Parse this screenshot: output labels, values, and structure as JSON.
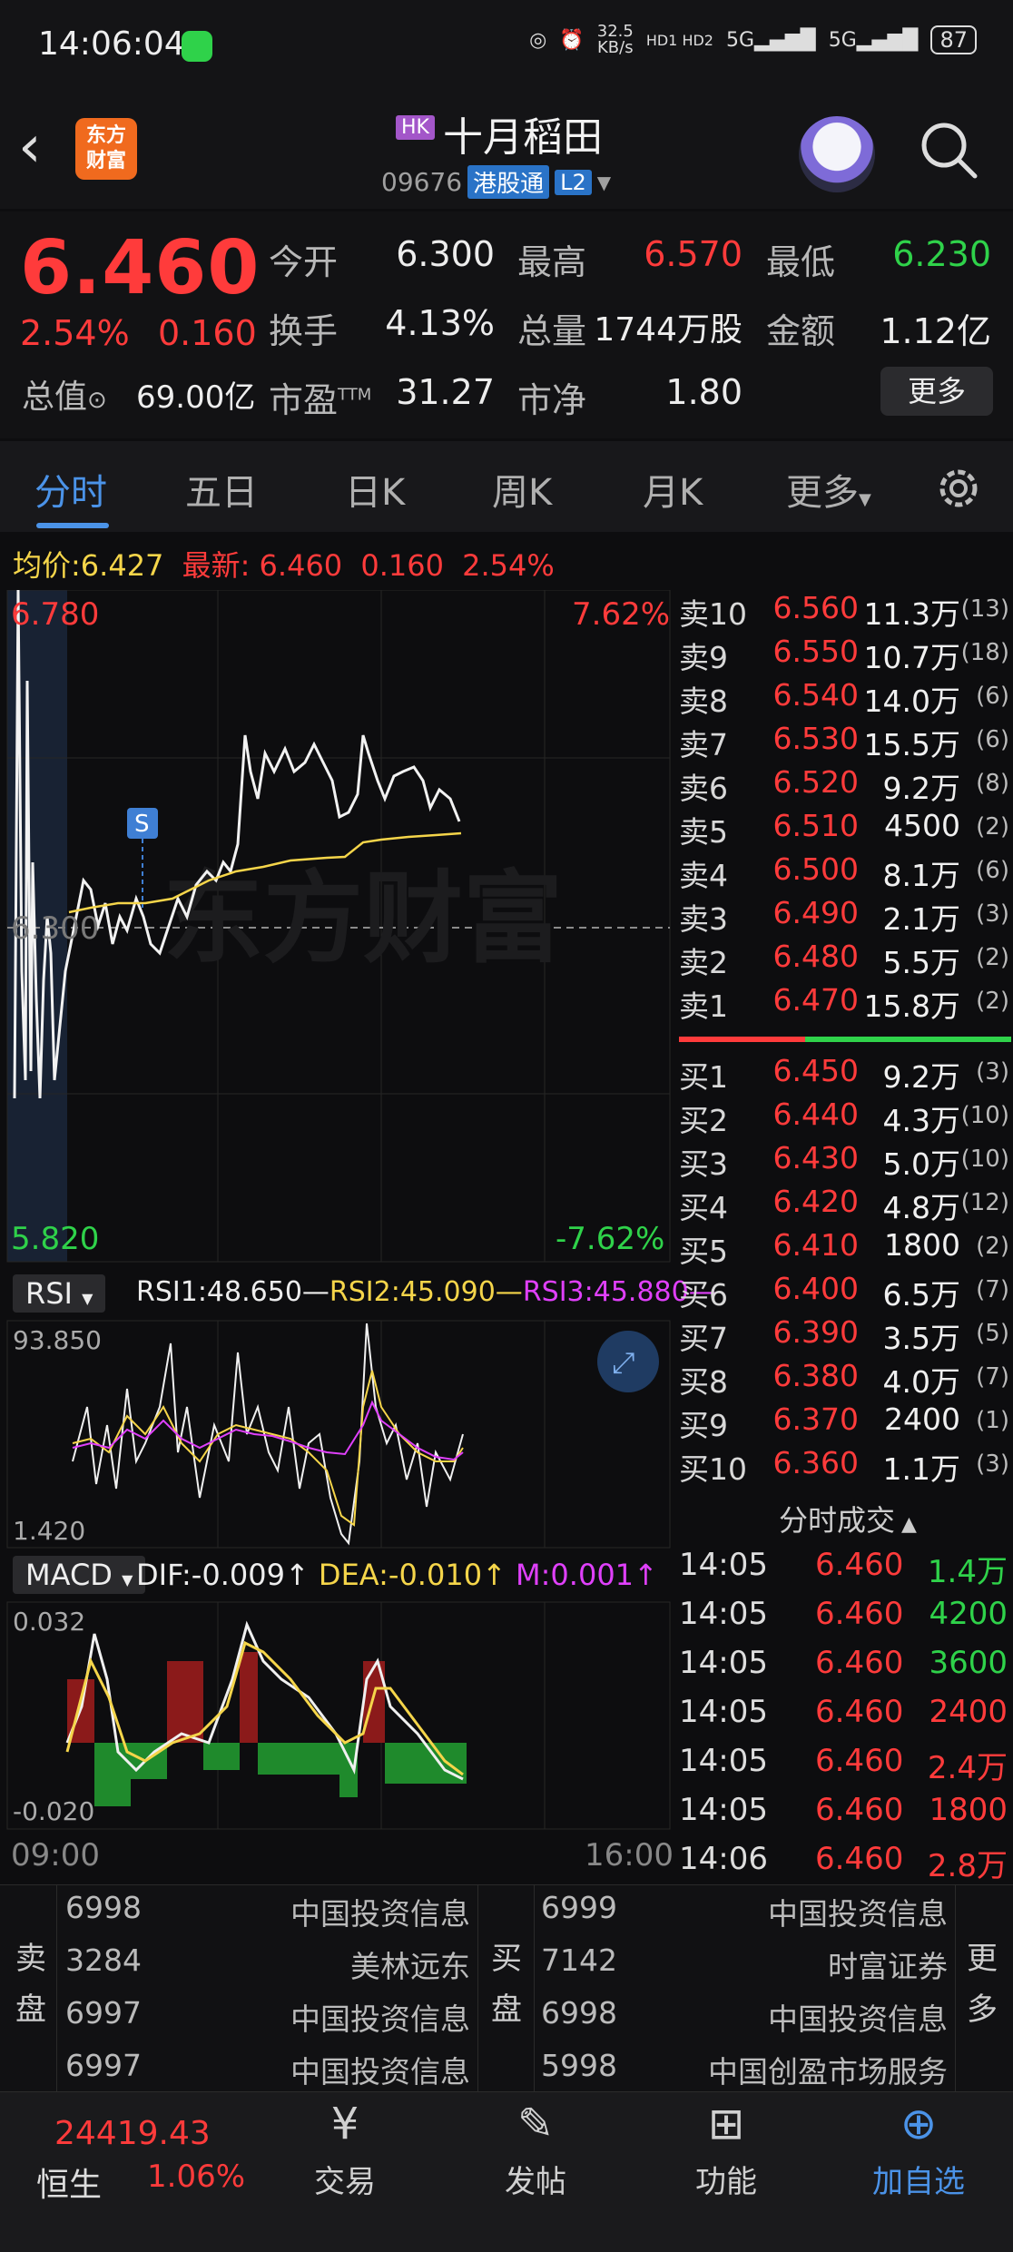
{
  "status_bar": {
    "time": "14:06:04",
    "net_speed_top": "32.5",
    "net_speed_bottom": "KB/s",
    "hd_badges": "HD1 HD2",
    "signal1": "5G",
    "signal2": "5G",
    "battery": "87"
  },
  "header": {
    "logo_line1": "东方",
    "logo_line2": "财富",
    "market_tag": "HK",
    "title": "十月稻田",
    "code": "09676",
    "connect_tag": "港股通",
    "level_tag": "L2"
  },
  "quote": {
    "price": "6.460",
    "pct": "2.54%",
    "change": "0.160",
    "mcap_label": "总值",
    "mcap_value": "69.00亿",
    "open_label": "今开",
    "open_value": "6.300",
    "high_label": "最高",
    "high_value": "6.570",
    "low_label": "最低",
    "low_value": "6.230",
    "turnover_label": "换手",
    "turnover_value": "4.13%",
    "volume_label": "总量",
    "volume_value": "1744万股",
    "amount_label": "金额",
    "amount_value": "1.12亿",
    "pe_label": "市盈",
    "pe_sup": "TTM",
    "pe_value": "31.27",
    "pb_label": "市净",
    "pb_value": "1.80",
    "more_button": "更多"
  },
  "tabs": [
    "分时",
    "五日",
    "日K",
    "周K",
    "月K",
    "更多"
  ],
  "info_line": {
    "avg_label": "均价:",
    "avg_value": "6.427",
    "latest_label": "最新:",
    "latest_value": "6.460",
    "latest_change": "0.160",
    "latest_pct": "2.54%"
  },
  "main_chart": {
    "y_top": "6.780",
    "y_bottom": "5.820",
    "pct_top": "7.62%",
    "pct_bottom": "-7.62%",
    "baseline": "6.300",
    "marker": "S",
    "watermark": "东方财富",
    "time_start": "09:00",
    "time_end": "16:00"
  },
  "rsi": {
    "button": "RSI",
    "rsi1": "RSI1:48.650—",
    "rsi2": "RSI2:45.090—",
    "rsi3": "RSI3:45.880—",
    "y_top": "93.850",
    "y_bottom": "1.420"
  },
  "macd": {
    "button": "MACD",
    "dif": "DIF:-0.009↑",
    "dea": "DEA:-0.010↑",
    "m": "M:0.001↑",
    "y_top": "0.032",
    "y_bottom": "-0.020"
  },
  "order_book": {
    "asks": [
      {
        "label": "卖10",
        "price": "6.560",
        "vol": "11.3万",
        "cnt": "(13)"
      },
      {
        "label": "卖9",
        "price": "6.550",
        "vol": "10.7万",
        "cnt": "(18)"
      },
      {
        "label": "卖8",
        "price": "6.540",
        "vol": "14.0万",
        "cnt": "(6)"
      },
      {
        "label": "卖7",
        "price": "6.530",
        "vol": "15.5万",
        "cnt": "(6)"
      },
      {
        "label": "卖6",
        "price": "6.520",
        "vol": "9.2万",
        "cnt": "(8)"
      },
      {
        "label": "卖5",
        "price": "6.510",
        "vol": "4500",
        "cnt": "(2)"
      },
      {
        "label": "卖4",
        "price": "6.500",
        "vol": "8.1万",
        "cnt": "(6)"
      },
      {
        "label": "卖3",
        "price": "6.490",
        "vol": "2.1万",
        "cnt": "(3)"
      },
      {
        "label": "卖2",
        "price": "6.480",
        "vol": "5.5万",
        "cnt": "(2)"
      },
      {
        "label": "卖1",
        "price": "6.470",
        "vol": "15.8万",
        "cnt": "(2)"
      }
    ],
    "bids": [
      {
        "label": "买1",
        "price": "6.450",
        "vol": "9.2万",
        "cnt": "(3)"
      },
      {
        "label": "买2",
        "price": "6.440",
        "vol": "4.3万",
        "cnt": "(10)"
      },
      {
        "label": "买3",
        "price": "6.430",
        "vol": "5.0万",
        "cnt": "(10)"
      },
      {
        "label": "买4",
        "price": "6.420",
        "vol": "4.8万",
        "cnt": "(12)"
      },
      {
        "label": "买5",
        "price": "6.410",
        "vol": "1800",
        "cnt": "(2)"
      },
      {
        "label": "买6",
        "price": "6.400",
        "vol": "6.5万",
        "cnt": "(7)"
      },
      {
        "label": "买7",
        "price": "6.390",
        "vol": "3.5万",
        "cnt": "(5)"
      },
      {
        "label": "买8",
        "price": "6.380",
        "vol": "4.0万",
        "cnt": "(7)"
      },
      {
        "label": "买9",
        "price": "6.370",
        "vol": "2400",
        "cnt": "(1)"
      },
      {
        "label": "买10",
        "price": "6.360",
        "vol": "1.1万",
        "cnt": "(3)"
      }
    ]
  },
  "trades": {
    "title": "分时成交",
    "rows": [
      {
        "time": "14:05",
        "price": "6.460",
        "vol": "1.4万",
        "color": "#2fd24a"
      },
      {
        "time": "14:05",
        "price": "6.460",
        "vol": "4200",
        "color": "#2fd24a"
      },
      {
        "time": "14:05",
        "price": "6.460",
        "vol": "3600",
        "color": "#2fd24a"
      },
      {
        "time": "14:05",
        "price": "6.460",
        "vol": "2400",
        "color": "#ff3b3b"
      },
      {
        "time": "14:05",
        "price": "6.460",
        "vol": "2.4万",
        "color": "#ff3b3b"
      },
      {
        "time": "14:05",
        "price": "6.460",
        "vol": "1800",
        "color": "#ff3b3b"
      },
      {
        "time": "14:06",
        "price": "6.460",
        "vol": "2.8万",
        "color": "#ff3b3b"
      }
    ]
  },
  "brokers": {
    "sell_side_label": "卖盘",
    "buy_side_label": "买盘",
    "more_label": "更多",
    "sell": [
      {
        "num": "6998",
        "name": "中国投资信息"
      },
      {
        "num": "3284",
        "name": "美林远东"
      },
      {
        "num": "6997",
        "name": "中国投资信息"
      },
      {
        "num": "6997",
        "name": "中国投资信息"
      }
    ],
    "buy": [
      {
        "num": "6999",
        "name": "中国投资信息"
      },
      {
        "num": "7142",
        "name": "时富证券"
      },
      {
        "num": "6998",
        "name": "中国投资信息"
      },
      {
        "num": "5998",
        "name": "中国创盈市场服务"
      }
    ]
  },
  "bottom_nav": {
    "index_value": "24419.43",
    "index_name": "恒生",
    "index_pct": "1.06%",
    "items": [
      "交易",
      "发帖",
      "功能",
      "加自选"
    ]
  },
  "colors": {
    "up": "#ff3b3b",
    "down": "#2fd24a",
    "accent": "#4b93e8",
    "avg_line": "#f5d54a"
  }
}
